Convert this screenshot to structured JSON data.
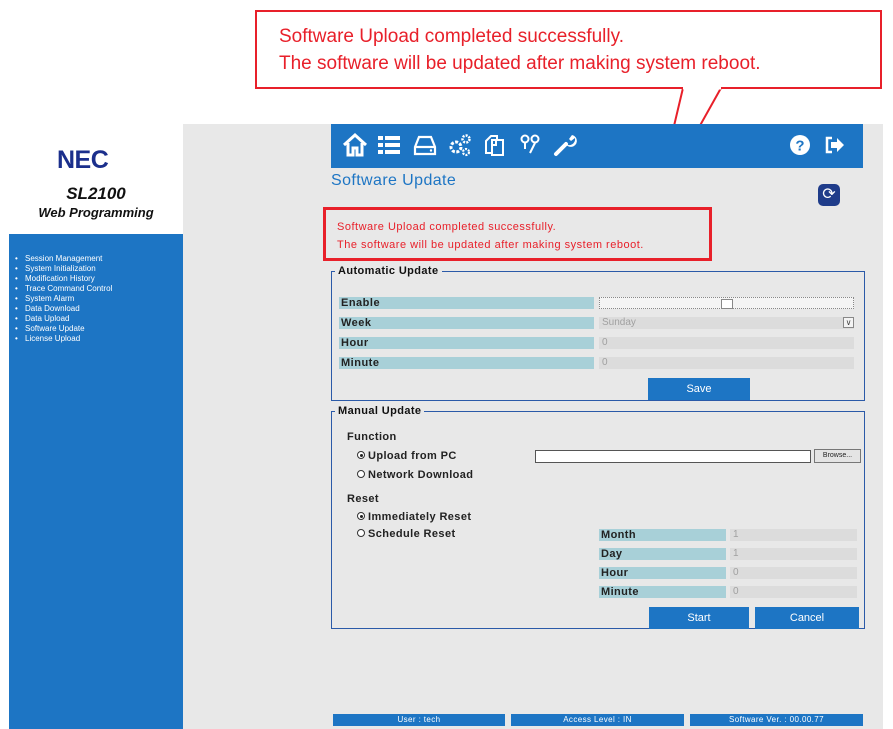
{
  "callout": {
    "line1": "Software Upload completed successfully.",
    "line2": "The software will be updated after making system reboot.",
    "color": "#e8202a"
  },
  "brand": {
    "logo": "NEC",
    "product": "SL2100",
    "subtitle": "Web Programming"
  },
  "sidebar": {
    "items": [
      {
        "label": "Session Management"
      },
      {
        "label": "System Initialization"
      },
      {
        "label": "Modification History"
      },
      {
        "label": "Trace Command Control"
      },
      {
        "label": "System Alarm"
      },
      {
        "label": "Data Download"
      },
      {
        "label": "Data Upload"
      },
      {
        "label": "Software Update"
      },
      {
        "label": "License Upload"
      }
    ]
  },
  "toolbar": {
    "icons": [
      "home-icon",
      "list-icon",
      "drive-icon",
      "settings-icon",
      "copy-icon",
      "users-icon",
      "wrench-icon",
      "help-icon",
      "logout-icon"
    ]
  },
  "page": {
    "title": "Software Update",
    "message_line1": "Software Upload completed successfully.",
    "message_line2": "The software will be updated after making system reboot."
  },
  "automatic_update": {
    "legend": "Automatic Update",
    "enable_label": "Enable",
    "week_label": "Week",
    "week_value": "Sunday",
    "hour_label": "Hour",
    "hour_value": "0",
    "minute_label": "Minute",
    "minute_value": "0",
    "save_label": "Save"
  },
  "manual_update": {
    "legend": "Manual Update",
    "function_label": "Function",
    "upload_from_pc": "Upload from PC",
    "network_download": "Network Download",
    "browse_label": "Browse...",
    "reset_label": "Reset",
    "immediately_reset": "Immediately Reset",
    "schedule_reset": "Schedule Reset",
    "month_label": "Month",
    "month_value": "1",
    "day_label": "Day",
    "day_value": "1",
    "hour_label": "Hour",
    "hour_value": "0",
    "minute_label": "Minute",
    "minute_value": "0",
    "start_label": "Start",
    "cancel_label": "Cancel"
  },
  "status": {
    "user": "User : tech",
    "access": "Access Level : IN",
    "software": "Software Ver. : 00.00.77"
  },
  "colors": {
    "brand_blue": "#1d75c4",
    "label_teal": "#a8d0d8",
    "error_red": "#e8202a"
  }
}
